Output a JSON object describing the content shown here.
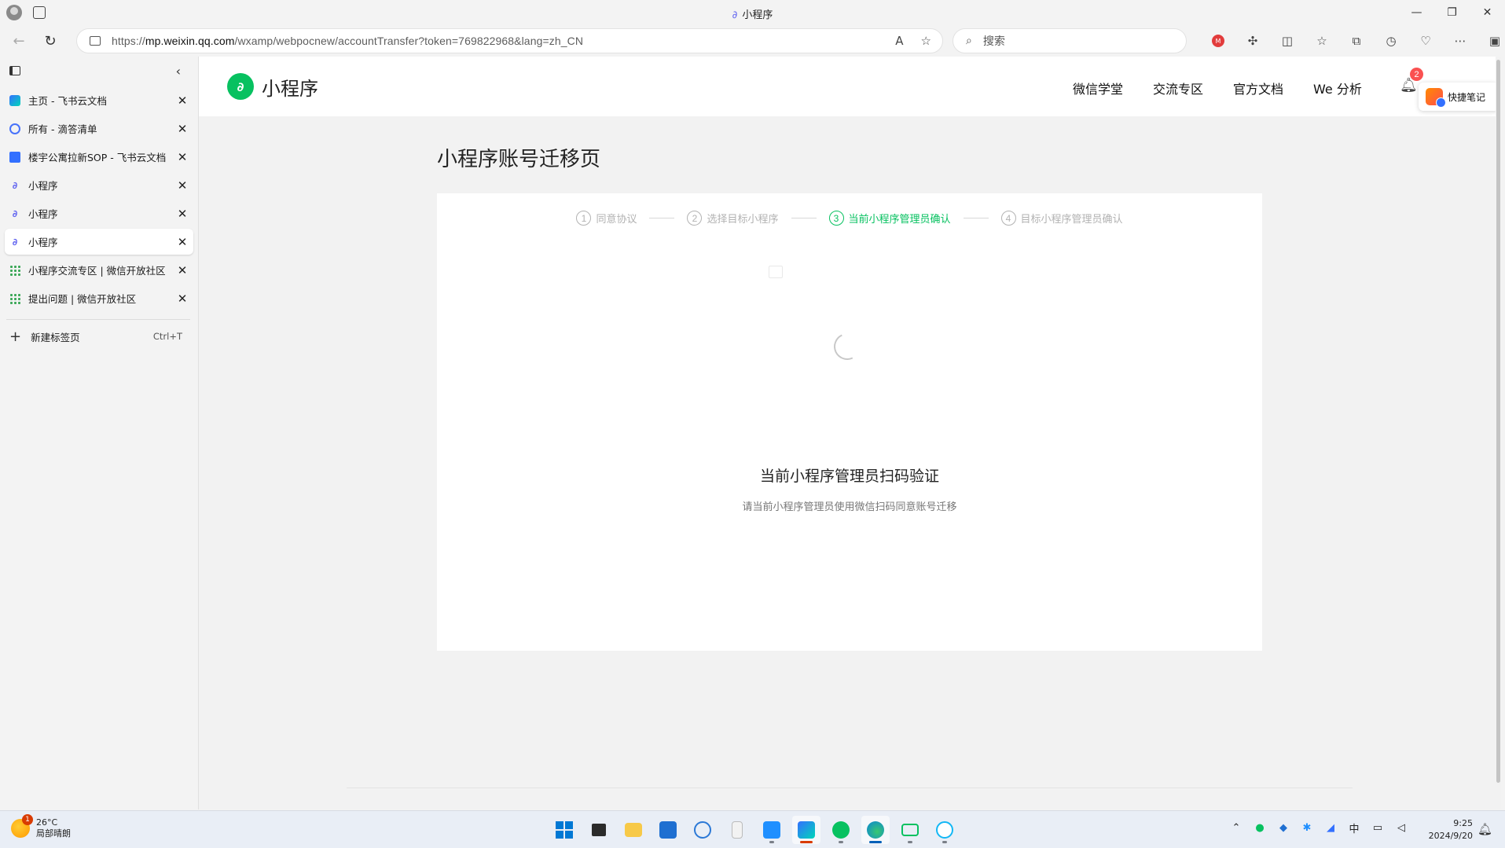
{
  "window": {
    "title": "小程序",
    "controls": [
      "—",
      "❐",
      "✕"
    ]
  },
  "toolbar": {
    "url_prefix": "https://",
    "url_host": "mp.weixin.qq.com",
    "url_path": "/wxamp/webpocnew/accountTransfer?token=769822968&lang=zh_CN",
    "search_placeholder": "搜索"
  },
  "sidebar": {
    "tabs": [
      {
        "label": "主页 - 飞书云文档",
        "icon": "feishu-icon",
        "active": false
      },
      {
        "label": "所有 - 滴答清单",
        "icon": "ticktick-icon",
        "active": false
      },
      {
        "label": "楼宇公寓拉新SOP - 飞书云文档",
        "icon": "feishu-doc-icon",
        "active": false
      },
      {
        "label": "小程序",
        "icon": "miniprogram-icon",
        "active": false
      },
      {
        "label": "小程序",
        "icon": "miniprogram-icon",
        "active": false
      },
      {
        "label": "小程序",
        "icon": "miniprogram-icon",
        "active": true
      },
      {
        "label": "小程序交流专区 | 微信开放社区",
        "icon": "wechat-community-icon",
        "active": false
      },
      {
        "label": "提出问题 | 微信开放社区",
        "icon": "wechat-community-icon",
        "active": false
      }
    ],
    "new_tab_label": "新建标签页",
    "new_tab_shortcut": "Ctrl+T"
  },
  "mp_header": {
    "brand": "小程序",
    "nav": [
      "微信学堂",
      "交流专区",
      "官方文档",
      "We 分析"
    ],
    "notification_count": "2",
    "quick_note_label": "快捷笔记"
  },
  "main": {
    "page_title": "小程序账号迁移页",
    "steps": [
      {
        "num": "1",
        "label": "同意协议"
      },
      {
        "num": "2",
        "label": "选择目标小程序"
      },
      {
        "num": "3",
        "label": "当前小程序管理员确认"
      },
      {
        "num": "4",
        "label": "目标小程序管理员确认"
      }
    ],
    "active_step": 3,
    "verify_title": "当前小程序管理员扫码验证",
    "verify_desc": "请当前小程序管理员使用微信扫码同意账号迁移"
  },
  "taskbar": {
    "weather_temp": "26°C",
    "weather_desc": "局部晴朗",
    "weather_badge": "1",
    "tray_ime": "中",
    "time": "9:25",
    "date": "2024/9/20"
  },
  "colors": {
    "wechat_green": "#07c160",
    "badge_red": "#fa5151",
    "mp_purple": "#6467f0"
  }
}
